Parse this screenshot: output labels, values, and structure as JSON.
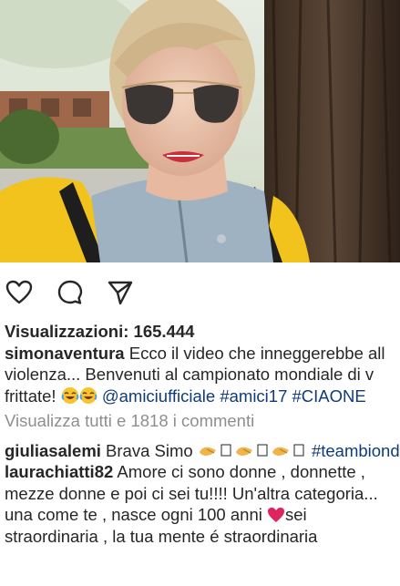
{
  "post": {
    "views_label": "Visualizzazioni:",
    "views_count": "165.444",
    "caption": {
      "author": "simonaventura",
      "line1": "Ecco il video che inneggerebbe all",
      "line2": "violenza... Benvenuti al campionato mondiale di v",
      "line3_text": "frittate!",
      "mention": "@amiciufficiale",
      "hashtag1": "#amici17",
      "hashtag2": "#CIAONE"
    },
    "view_all_comments": "Visualizza tutti e 1818 i commenti"
  },
  "comments": [
    {
      "author": "giuliasalemi",
      "text": "Brava Simo",
      "tail_hashtag": "#teambiondo"
    },
    {
      "author": "laurachiatti82",
      "line1": "Amore ci sono donne , donnette ,",
      "line2": "mezze donne e poi ci sei tu!!!! Un'altra categoria...",
      "line3_before": "una come te , nasce ogni 100 anni",
      "line3_after": "sei",
      "line4": "straordinaria , la tua mente é straordinaria"
    }
  ],
  "icons": {
    "like": "heart-outline-icon",
    "comment": "comment-bubble-icon",
    "share": "paper-plane-icon",
    "emoji_laugh": "tears-of-joy-emoji",
    "emoji_clap": "clapping-hands-emoji",
    "emoji_heart": "red-heart-emoji"
  },
  "colors": {
    "text": "#262626",
    "link": "#0f3b7a",
    "muted": "#8e8e8e",
    "heart": "#e0245e"
  }
}
